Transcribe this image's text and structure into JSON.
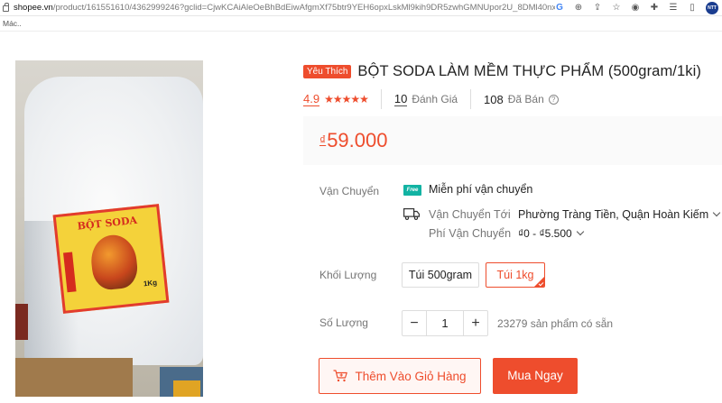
{
  "browser": {
    "url_domain": "shopee.vn",
    "url_path": "/product/161551610/4362999246?gclid=CjwKCAiAleOeBhBdEiwAfgmXf75btr9YEH6opxLskMl9kih9DR5zwhGMNUpor2U_8DMl40nx6...",
    "bookmarks_label": "Mác..",
    "ext_badge": "NTT"
  },
  "product": {
    "favorite_badge": "Yêu Thích",
    "title": "BỘT SODA LÀM MỀM THỰC PHẨM (500gram/1ki)",
    "rating": "4.9",
    "stars": "★★★★★",
    "review_count": "10",
    "review_label": "Đánh Giá",
    "sold_count": "108",
    "sold_label": "Đã Bán",
    "price_currency": "₫",
    "price": "59.000",
    "image_label_title": "BỘT SODA",
    "image_label_weight": "1Kg"
  },
  "shipping": {
    "label": "Vận Chuyển",
    "free_badge": "Free",
    "free_text": "Miễn phí vận chuyển",
    "ship_to_label": "Vận Chuyển Tới",
    "ship_to_value": "Phường Tràng Tiền, Quận Hoàn Kiếm",
    "fee_label": "Phí Vận Chuyển",
    "fee_value": "₫0 - ₫5.500"
  },
  "weight": {
    "label": "Khối Lượng",
    "options": [
      "Túi 500gram",
      "Túi 1kg"
    ],
    "selected": "Túi 1kg"
  },
  "quantity": {
    "label": "Số Lượng",
    "minus": "−",
    "value": "1",
    "plus": "+",
    "stock": "23279 sản phẩm có sẵn"
  },
  "actions": {
    "add_to_cart": "Thêm Vào Giỏ Hàng",
    "buy_now": "Mua Ngay"
  },
  "colors": {
    "accent": "#ee4d2d",
    "free_badge": "#12b3a3"
  }
}
